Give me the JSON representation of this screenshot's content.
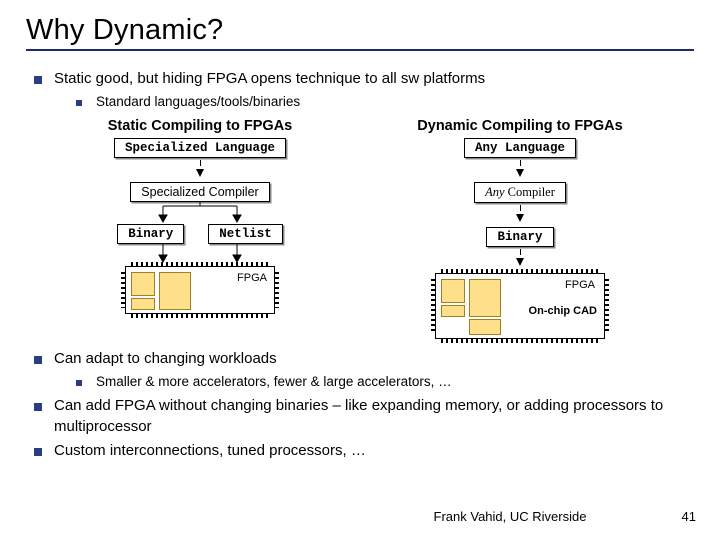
{
  "title": "Why Dynamic?",
  "b1": "Static good, but hiding FPGA opens technique to all sw platforms",
  "b1a": "Standard languages/tools/binaries",
  "left": {
    "title": "Static Compiling to FPGAs",
    "lang": "Specialized Language",
    "comp": "Specialized Compiler",
    "bin": "Binary",
    "net": "Netlist",
    "fpga": "FPGA"
  },
  "right": {
    "title": "Dynamic Compiling to FPGAs",
    "lang": "Any Language",
    "comp_prefix": "Any",
    "comp_suffix": " Compiler",
    "bin": "Binary",
    "fpga": "FPGA",
    "cad": "On-chip CAD"
  },
  "b2": "Can adapt to changing workloads",
  "b2a": "Smaller & more accelerators, fewer & large accelerators, …",
  "b3": "Can add FPGA without changing binaries – like expanding memory, or adding processors to multiprocessor",
  "b4": "Custom interconnections, tuned processors, …",
  "footer": "Frank Vahid, UC Riverside",
  "pagenum": "41"
}
